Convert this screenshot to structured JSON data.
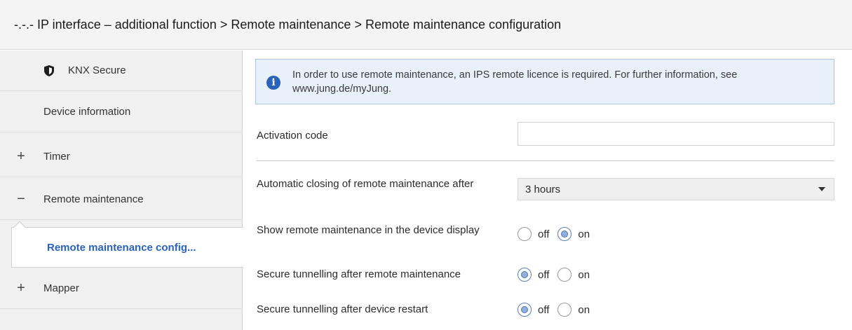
{
  "header": {
    "title": "-.-.- IP interface – additional function > Remote maintenance > Remote maintenance configuration"
  },
  "sidebar": {
    "items": [
      {
        "label": "KNX Secure",
        "icon": "shield-icon"
      },
      {
        "label": "Device information"
      },
      {
        "label": "Timer",
        "expander": "+"
      },
      {
        "label": "Remote maintenance",
        "expander": "−"
      },
      {
        "label": "Remote maintenance config..."
      },
      {
        "label": "Mapper",
        "expander": "+"
      }
    ]
  },
  "info": {
    "icon": "info-icon",
    "text": "In order to use remote maintenance, an IPS remote licence is required. For further information, see www.jung.de/myJung."
  },
  "params": {
    "activation_code": {
      "label": "Activation code",
      "value": ""
    },
    "auto_close": {
      "label": "Automatic closing of remote maintenance after",
      "value": "3 hours"
    },
    "show_in_display": {
      "label": "Show remote maintenance in the device display",
      "options": [
        "off",
        "on"
      ],
      "selected": "on"
    },
    "secure_after_maint": {
      "label": "Secure tunnelling after remote maintenance",
      "options": [
        "off",
        "on"
      ],
      "selected": "off"
    },
    "secure_after_restart": {
      "label": "Secure tunnelling after device restart",
      "options": [
        "off",
        "on"
      ],
      "selected": "off"
    }
  },
  "colors": {
    "accent": "#2a63b7",
    "info_background": "#e8f1fa",
    "info_border": "#a9c4e4"
  }
}
